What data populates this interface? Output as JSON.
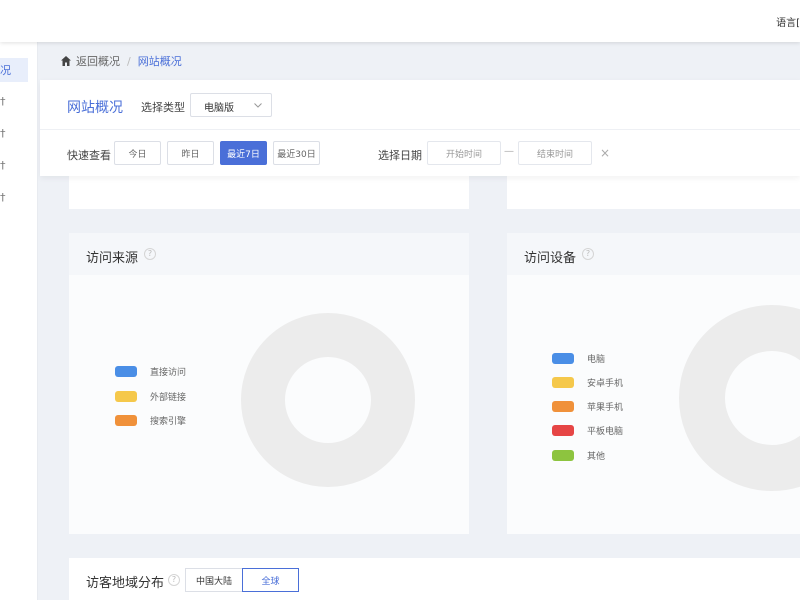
{
  "topbar": {
    "lang_label": "语言["
  },
  "sidebar": {
    "active_label": "况",
    "sub_items": [
      "†",
      "†",
      "†",
      "†"
    ]
  },
  "breadcrumb": {
    "back": "返回概况",
    "separator": "/",
    "current": "网站概况"
  },
  "filters": {
    "title": "网站概况",
    "type_label": "选择类型",
    "type_value": "电脑版",
    "quick_label": "快速查看",
    "quick_buttons": [
      "今日",
      "昨日",
      "最近7日",
      "最近30日"
    ],
    "active_quick": "最近7日",
    "date_label": "选择日期",
    "start_placeholder": "开始时间",
    "date_separator": "—",
    "end_placeholder": "结束时间",
    "clear": "×"
  },
  "cards": {
    "source": {
      "title": "访问来源",
      "help": "?",
      "legend": [
        {
          "label": "直接访问",
          "color": "#4a8ee6"
        },
        {
          "label": "外部链接",
          "color": "#f5c84b"
        },
        {
          "label": "搜索引擎",
          "color": "#f0913a"
        }
      ]
    },
    "device": {
      "title": "访问设备",
      "help": "?",
      "legend": [
        {
          "label": "电脑",
          "color": "#4a8ee6"
        },
        {
          "label": "安卓手机",
          "color": "#f5c84b"
        },
        {
          "label": "苹果手机",
          "color": "#f0913a"
        },
        {
          "label": "平板电脑",
          "color": "#e64545"
        },
        {
          "label": "其他",
          "color": "#8dc43f"
        }
      ]
    }
  },
  "region": {
    "title": "访客地域分布",
    "help": "?",
    "buttons": [
      "中国大陆",
      "全球"
    ],
    "active": "全球"
  },
  "colors": {
    "accent": "#4a6fd8",
    "donut_empty": "#ececec",
    "page_bg": "#eef1f6"
  }
}
